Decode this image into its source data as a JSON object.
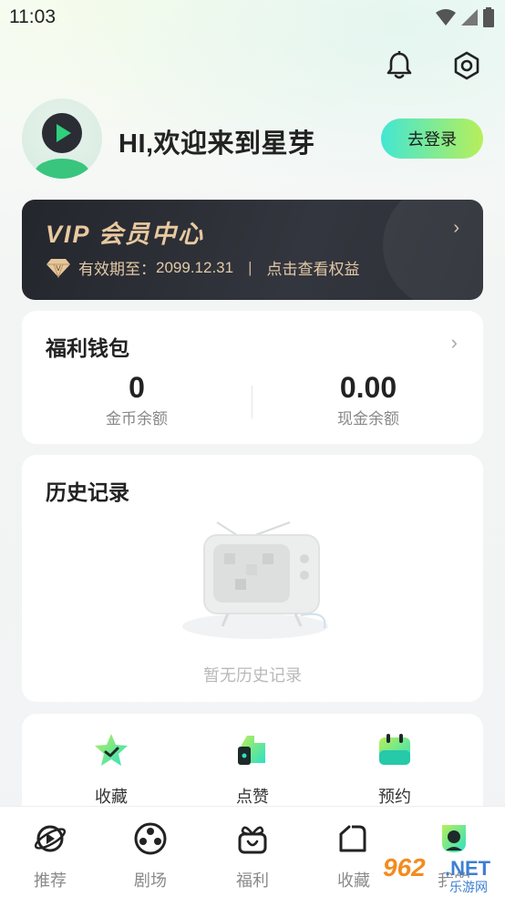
{
  "status_bar": {
    "time": "11:03"
  },
  "header": {
    "greeting": "HI,欢迎来到星芽",
    "login_label": "去登录"
  },
  "vip": {
    "title": "VIP 会员中心",
    "expiry_label": "有效期至：",
    "expiry_date": "2099.12.31",
    "separator": "|",
    "benefits_link": "点击查看权益"
  },
  "wallet": {
    "title": "福利钱包",
    "coins": {
      "value": "0",
      "label": "金币余额"
    },
    "cash": {
      "value": "0.00",
      "label": "现金余额"
    }
  },
  "history": {
    "title": "历史记录",
    "empty_text": "暂无历史记录"
  },
  "quick_actions": [
    {
      "label": "收藏",
      "icon": "star-check-icon"
    },
    {
      "label": "点赞",
      "icon": "thumb-up-icon"
    },
    {
      "label": "预约",
      "icon": "calendar-icon"
    }
  ],
  "bottom_nav": [
    {
      "label": "推荐",
      "icon": "planet-icon"
    },
    {
      "label": "剧场",
      "icon": "film-reel-icon"
    },
    {
      "label": "福利",
      "icon": "gift-icon"
    },
    {
      "label": "收藏",
      "icon": "folder-icon"
    },
    {
      "label": "我的",
      "icon": "profile-icon"
    }
  ],
  "watermark": {
    "number": "962",
    "net": ".NET",
    "cn": "乐游网"
  },
  "colors": {
    "accent_start": "#43e6d2",
    "accent_end": "#b7ef5a",
    "vip_gold": "#e9c9a0",
    "vip_bg": "#2a2c33"
  }
}
